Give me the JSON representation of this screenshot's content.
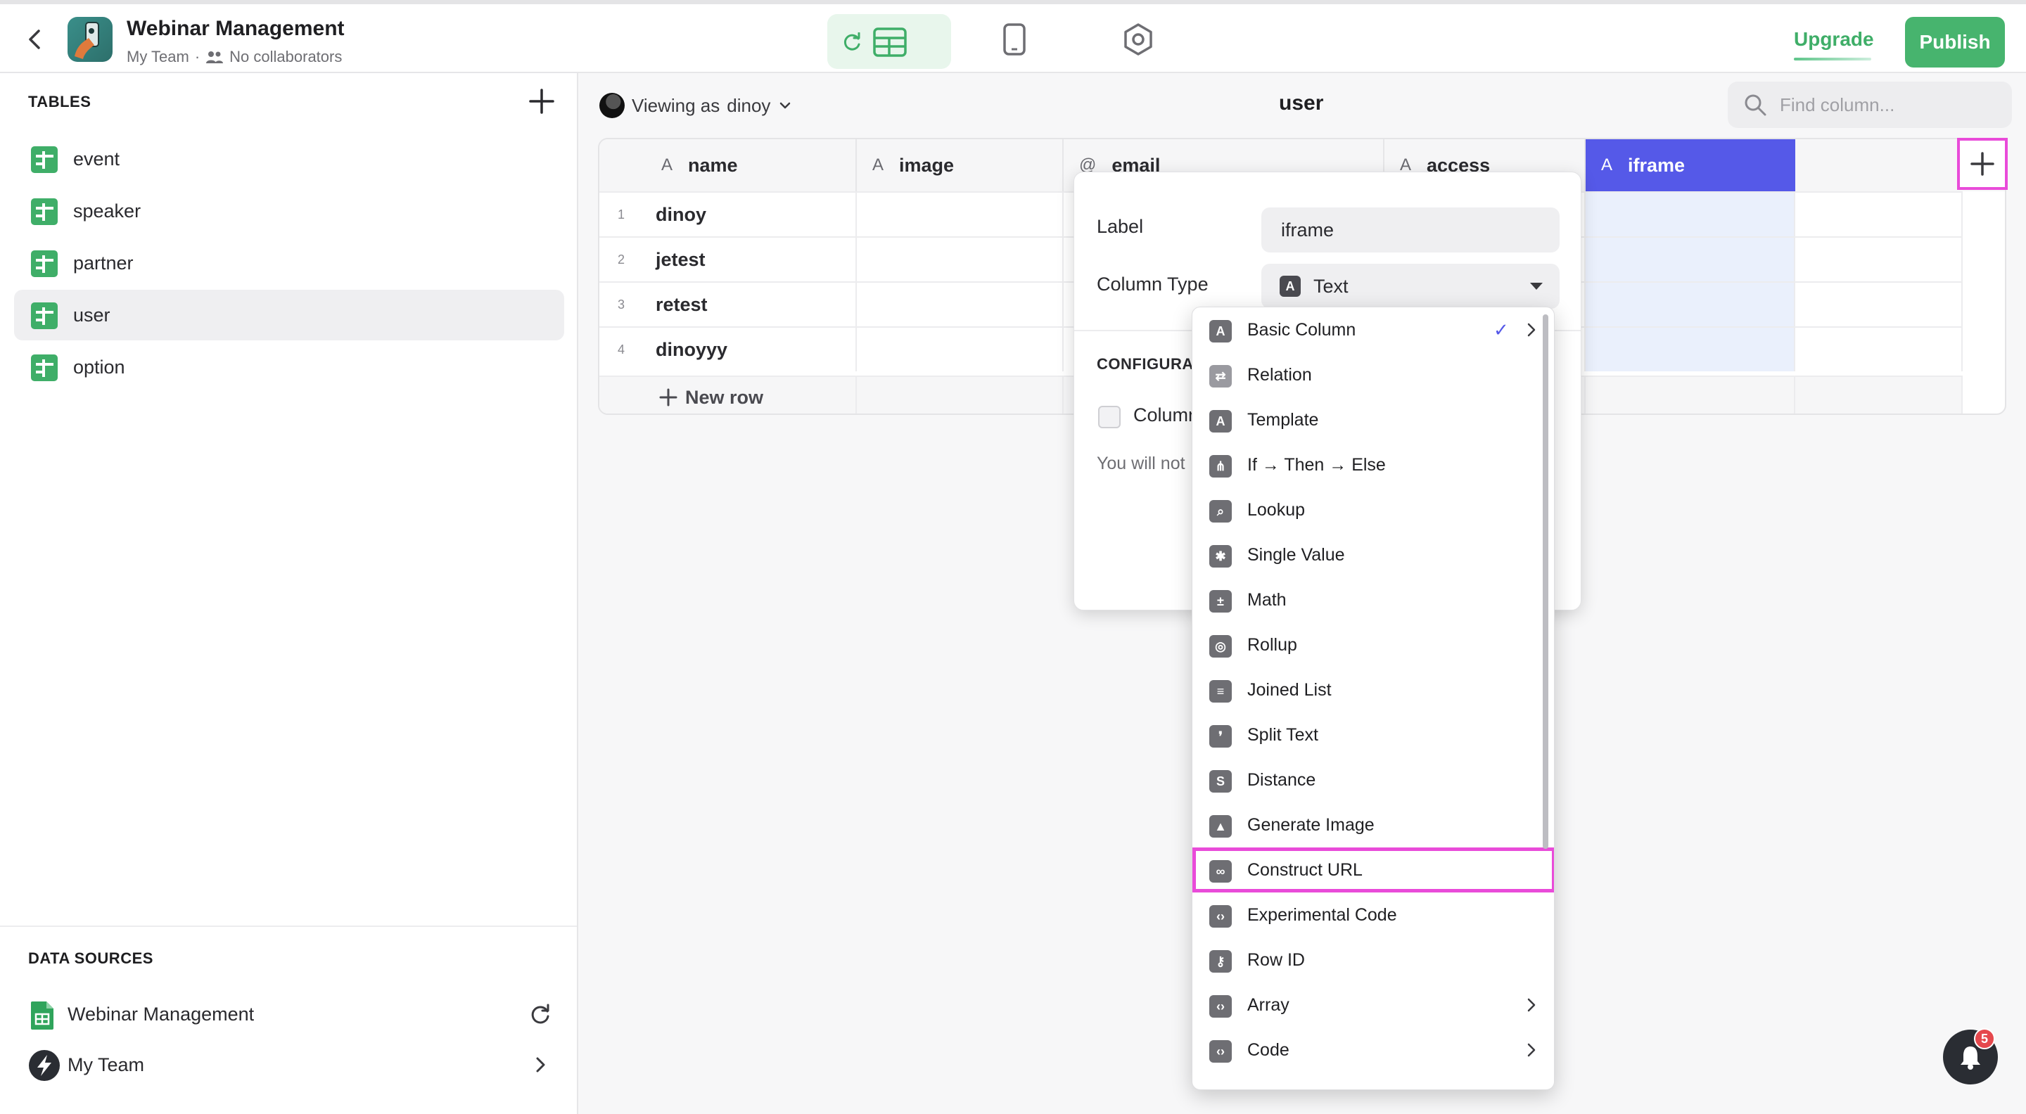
{
  "header": {
    "app_title": "Webinar Management",
    "team": "My Team",
    "separator": "·",
    "collaborators": "No collaborators",
    "upgrade_label": "Upgrade",
    "publish_label": "Publish",
    "accent_color": "#47b46e"
  },
  "sidebar": {
    "tables_title": "TABLES",
    "tables": [
      {
        "label": "event"
      },
      {
        "label": "speaker"
      },
      {
        "label": "partner"
      },
      {
        "label": "user",
        "active": true
      },
      {
        "label": "option"
      }
    ],
    "data_sources_title": "DATA SOURCES",
    "sources": [
      {
        "label": "Webinar Management",
        "icon": "sheets-icon"
      },
      {
        "label": "My Team",
        "icon": "bolt-icon"
      }
    ]
  },
  "main": {
    "viewing_as": "Viewing as",
    "viewer": "dinoy",
    "table_title": "user",
    "find_placeholder": "Find column..."
  },
  "grid": {
    "columns": [
      {
        "label": "name",
        "type_icon": "A"
      },
      {
        "label": "image",
        "type_icon": "A"
      },
      {
        "label": "email",
        "type_icon": "@"
      },
      {
        "label": "access",
        "type_icon": "A"
      },
      {
        "label": "iframe",
        "type_icon": "A",
        "selected": true
      }
    ],
    "rows": [
      {
        "num": "1",
        "name": "dinoy"
      },
      {
        "num": "2",
        "name": "jetest"
      },
      {
        "num": "3",
        "name": "retest"
      },
      {
        "num": "4",
        "name": "dinoyyy"
      }
    ],
    "new_row_label": "New row",
    "selected_color": "#5559e8"
  },
  "panel": {
    "label_label": "Label",
    "label_value": "iframe",
    "type_label": "Column Type",
    "type_value": "Text",
    "type_icon": "A",
    "config_title": "CONFIGURAT",
    "checkbox_label": "Column",
    "note": "You will not"
  },
  "dropdown": {
    "items": [
      {
        "label": "Basic Column",
        "icon": "text-icon",
        "glyph": "A",
        "checked": true,
        "submenu": true
      },
      {
        "label": "Relation",
        "icon": "relation-icon",
        "glyph": "⇄"
      },
      {
        "label": "Template",
        "icon": "template-icon",
        "glyph": "A"
      },
      {
        "label": "If → Then → Else",
        "icon": "if-then-else-icon",
        "glyph": "⋔"
      },
      {
        "label": "Lookup",
        "icon": "lookup-icon",
        "glyph": "⌕"
      },
      {
        "label": "Single Value",
        "icon": "single-value-icon",
        "glyph": "✱"
      },
      {
        "label": "Math",
        "icon": "math-icon",
        "glyph": "±"
      },
      {
        "label": "Rollup",
        "icon": "rollup-icon",
        "glyph": "◎"
      },
      {
        "label": "Joined List",
        "icon": "joined-list-icon",
        "glyph": "≡"
      },
      {
        "label": "Split Text",
        "icon": "split-text-icon",
        "glyph": "❜"
      },
      {
        "label": "Distance",
        "icon": "distance-icon",
        "glyph": "S"
      },
      {
        "label": "Generate Image",
        "icon": "image-icon",
        "glyph": "▲"
      },
      {
        "label": "Construct URL",
        "icon": "link-icon",
        "glyph": "∞",
        "highlighted": true
      },
      {
        "label": "Experimental Code",
        "icon": "code-icon",
        "glyph": "‹›"
      },
      {
        "label": "Row ID",
        "icon": "key-icon",
        "glyph": "⚷"
      },
      {
        "label": "Array",
        "icon": "code-icon",
        "glyph": "‹›",
        "submenu": true
      },
      {
        "label": "Code",
        "icon": "code-icon",
        "glyph": "‹›",
        "submenu": true
      }
    ],
    "highlight_color": "#e94bd9"
  },
  "notifications": {
    "count": "5"
  }
}
